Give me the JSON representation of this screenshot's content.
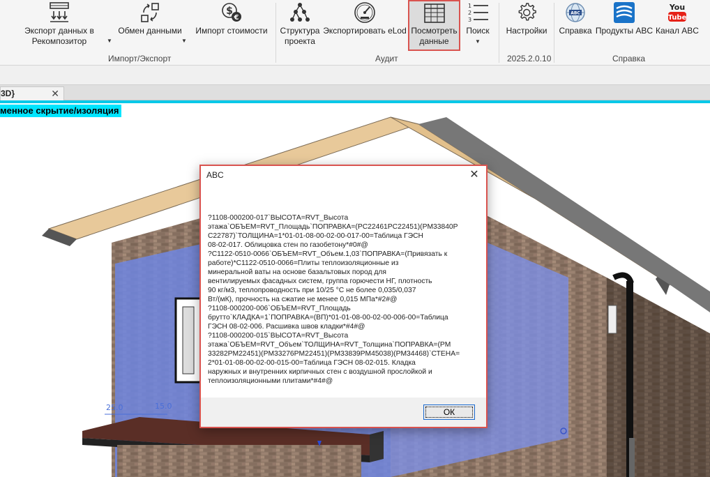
{
  "ribbon": {
    "buttons": {
      "export": "Экспорт данных в Рекомпозитор",
      "exchange": "Обмен данными",
      "import_cost": "Импорт стоимости",
      "structure": "Структура проекта",
      "export_elod": "Экспортировать eLod",
      "view_data": "Посмотреть данные",
      "search": "Поиск",
      "settings": "Настройки",
      "help": "Справка",
      "abc_products": "Продукты ABC",
      "abc_channel": "Канал ABC"
    },
    "groups": {
      "import_export": "Импорт/Экспорт",
      "audit": "Аудит",
      "version": "2025.2.0.10",
      "help": "Справка"
    },
    "icons": {
      "youtube_you": "You",
      "youtube_tube": "Tube"
    }
  },
  "tab": {
    "label": "3D}",
    "close": "✕"
  },
  "view": {
    "label": "менное скрытие/изоляция",
    "dim_left": "25.0",
    "dim_right": "15.0"
  },
  "dialog": {
    "title": "ABC",
    "close": "✕",
    "lines": [
      "?1108-000200-017`ВЫСОТА=RVT_Высота",
      "этажа`ОБЪЕМ=RVT_Площадь`ПОПРАВКА=(PC22461PC22451)(PM33840P",
      "C22787)`ТОЛЩИНА=1*01-01-08-00-02-00-017-00=Таблица ГЭСН",
      "08-02-017. Облицовка стен по газобетону*#0#@",
      "?C1122-0510-0066`ОБЪЕМ=RVT_Объем.1,03`ПОПРАВКА=(Привязать к",
      "работе)*С1122-0510-0066=Плиты теплоизоляционные из",
      "минеральной ваты на основе базальтовых пород для",
      "вентилируемых фасадных систем, группа горючести НГ, плотность",
      "90 кг/м3, теплопроводность при 10/25 °С не более 0,035/0,037",
      "Вт/(мК), прочность на сжатие не менее 0,015 МПа*#2#@",
      "?1108-000200-006`ОБЪЕМ=RVT_Площадь",
      "брутто`КЛАДКА=1`ПОПРАВКА=(ВП)*01-01-08-00-02-00-006-00=Таблица",
      "ГЭСН 08-02-006. Расшивка швов кладки*#4#@",
      "?1108-000200-015`ВЫСОТА=RVT_Высота",
      "этажа`ОБЪЕМ=RVT_Объем`ТОЛЩИНА=RVT_Толщина`ПОПРАВКА=(PM",
      "33282PM22451)(PM33276PM22451)(PM33839PM45038)(PM34468)`СТЕНА=",
      "2*01-01-08-00-02-00-015-00=Таблица ГЭСН 08-02-015. Кладка",
      "наружных и внутренних кирпичных стен с воздушной прослойкой и",
      "теплоизоляционными плитами*#4#@"
    ],
    "ok": "ОК"
  }
}
